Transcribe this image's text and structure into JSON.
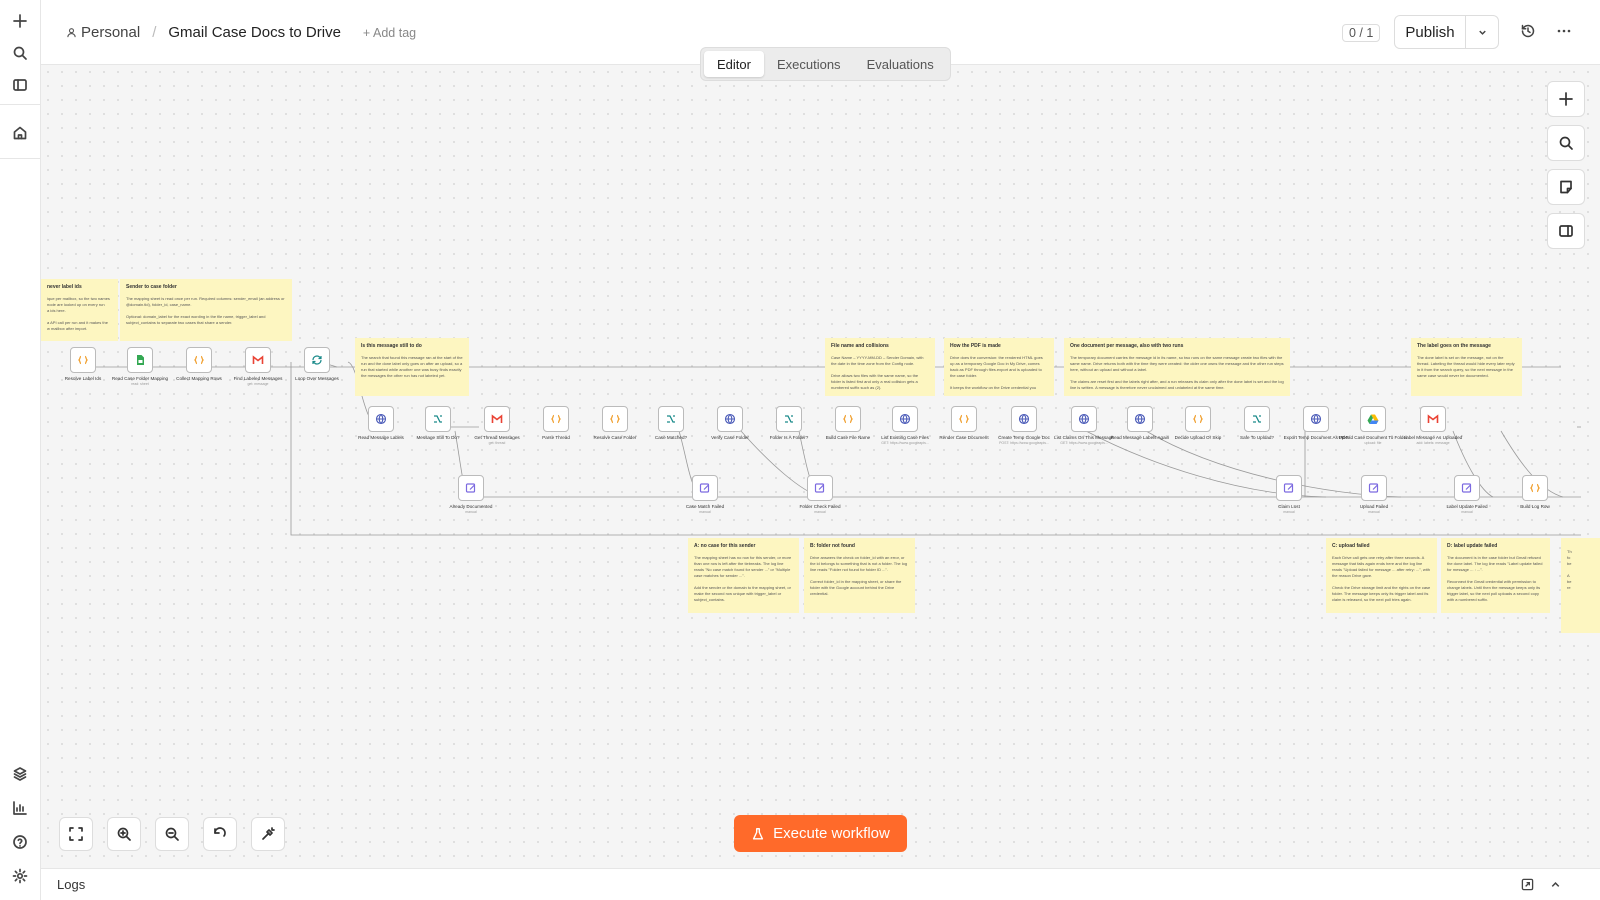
{
  "breadcrumb": {
    "project": "Personal",
    "separator": "/",
    "workflow_name": "Gmail Case Docs to Drive",
    "add_tag": "+ Add tag"
  },
  "header": {
    "counter": "0 / 1",
    "publish": "Publish"
  },
  "tabs": [
    {
      "label": "Editor"
    },
    {
      "label": "Executions"
    },
    {
      "label": "Evaluations"
    }
  ],
  "execute_button": "Execute workflow",
  "logs_label": "Logs",
  "icons": {
    "sidebar": [
      "plus-icon",
      "search-icon",
      "panel-icon",
      "home-icon",
      "templates-icon",
      "insights-icon",
      "help-icon",
      "settings-icon"
    ]
  },
  "colors": {
    "accent": "#ff6a2a",
    "sticky": "#fdf6c1",
    "code": "#f0a030",
    "gmail": "#ea4335",
    "sheets": "#34a853",
    "switch": "#1a8a8a",
    "http": "#4a5ab8",
    "set": "#7c6ae0"
  },
  "sticky_notes": [
    {
      "title": "never label ids",
      "body": "ique per mailbox, so the two names\n node are looked up on every run\n a ids here.\n\n a API call per run and it makes the\n w mailbox after import."
    },
    {
      "title": "Sender to case folder",
      "body": "The mapping sheet is read once per run. Required columns: sender_email (an address or @domain.tld), folder_id, case_name.\n\nOptional: domain_label for the exact wording in the file name, trigger_label and subject_contains to separate two cases that share a sender."
    },
    {
      "title": "Is this message still to do",
      "body": "The search that found this message ran at the start of the run and the done label only goes on after an upload, so a run that started while another one was busy finds exactly the messages the other run has not labeled yet."
    },
    {
      "title": "File name and collisions",
      "body": "Case Name – YYYY-MM-DD – Sender Domain, with the date in the time zone from the Config node.\n\nDrive allows two files with the same name, so the folder is listed first and only a real collision gets a numbered suffix such as (2)."
    },
    {
      "title": "How the PDF is made",
      "body": "Drive does the conversion: the rendered HTML goes up as a temporary Google Doc in My Drive, comes back as PDF through files.export and is uploaded to the case folder.\n\nIt keeps the workflow on the Drive credential you"
    },
    {
      "title": "One document per message, also with two runs",
      "body": "The temporary document carries the message id in its name, so two runs on the same message create two files with the same name. Drive returns both with the time they were created: the older one owns the message and the other run steps here, without an upload and without a label.\n\nThe claims are reset first and the labels right after, and a run releases its claim only after the done label is set and the log line is written. A message is therefore never unclaimed and unlabeled at the same time."
    },
    {
      "title": "The label goes on the message",
      "body": "The done label is set on the message, not on the thread. Labeling the thread would hide every later reply in it from the search query, so the next message in the same case would never be documented."
    },
    {
      "title": "A: no case for this sender",
      "body": "The mapping sheet has no row for this sender, or more than one row is left after the tiebreaks. The log line reads \"No case match found for sender ...\" or \"Multiple case matches for sender ...\".\n\nAdd the sender or the domain to the mapping sheet, or make the second row unique with trigger_label or subject_contains."
    },
    {
      "title": "B: folder not found",
      "body": "Drive answers the check on folder_id with an error, or the id belongs to something that is not a folder. The log line reads \"Folder not found for folder ID ...\".\n\nCorrect folder_id in the mapping sheet, or share the folder with the Google account behind the Drive credential."
    },
    {
      "title": "C: upload failed",
      "body": "Each Drive call gets one retry after three seconds. A message that fails again ends here and the log line reads \"Upload failed for message ... after retry: ...\", with the reason Drive gave.\n\nCheck the Drive storage limit and the rights on the case folder. The message keeps only its trigger label and its claim is released, so the next poll tries again."
    },
    {
      "title": "D: label update failed",
      "body": "The document is in the case folder but Gmail refused the done label. The log line reads \"Label update failed for message ... : ...\".\n\nReconnect the Gmail credential with permission to change labels. Until then the message keeps only its trigger label, so the next poll uploads a second copy with a numbered suffix."
    },
    {
      "title": "",
      "body": "Th\nfo\nbe\n\nA\nbe\nre"
    }
  ],
  "nodes": [
    {
      "label": "Resolve Label Ids",
      "sub": "",
      "type": "code"
    },
    {
      "label": "Read Case Folder Mapping",
      "sub": "read: sheet",
      "type": "sheets"
    },
    {
      "label": "Collect Mapping Rows",
      "sub": "",
      "type": "code"
    },
    {
      "label": "Find Labeled Messages",
      "sub": "get: message",
      "type": "gmail"
    },
    {
      "label": "Loop Over Messages",
      "sub": "",
      "type": "loop"
    },
    {
      "label": "Read Message Labels",
      "sub": "",
      "type": "http"
    },
    {
      "label": "Message Still To Do?",
      "sub": "",
      "type": "switch"
    },
    {
      "label": "Get Thread Messages",
      "sub": "get: thread",
      "type": "gmail"
    },
    {
      "label": "Parse Thread",
      "sub": "",
      "type": "code"
    },
    {
      "label": "Resolve Case Folder",
      "sub": "",
      "type": "code"
    },
    {
      "label": "Case Matched?",
      "sub": "",
      "type": "switch"
    },
    {
      "label": "Verify Case Folder",
      "sub": "",
      "type": "http"
    },
    {
      "label": "Folder Is A Folder?",
      "sub": "",
      "type": "switch"
    },
    {
      "label": "Build Case File Name",
      "sub": "",
      "type": "code"
    },
    {
      "label": "List Existing Case Files",
      "sub": "GET: https://www.googleapis...",
      "type": "http"
    },
    {
      "label": "Render Case Document",
      "sub": "",
      "type": "code"
    },
    {
      "label": "Create Temp Google Doc",
      "sub": "POST: https://www.googleapis...",
      "type": "http"
    },
    {
      "label": "List Claims On This Message",
      "sub": "GET: https://www.googleapis...",
      "type": "http"
    },
    {
      "label": "Read Message Labels Again",
      "sub": "",
      "type": "http"
    },
    {
      "label": "Decide Upload Or Skip",
      "sub": "",
      "type": "code"
    },
    {
      "label": "Safe To Upload?",
      "sub": "",
      "type": "switch"
    },
    {
      "label": "Export Temp Document As PDF",
      "sub": "",
      "type": "http"
    },
    {
      "label": "Upload Case Document To Folder",
      "sub": "upload: file",
      "type": "drive"
    },
    {
      "label": "Label Message As Uploaded",
      "sub": "add: labels: message",
      "type": "gmail"
    },
    {
      "label": "Already Documented",
      "sub": "manual",
      "type": "set"
    },
    {
      "label": "Case Match Failed",
      "sub": "manual",
      "type": "set"
    },
    {
      "label": "Folder Check Failed",
      "sub": "manual",
      "type": "set"
    },
    {
      "label": "Claim Lost",
      "sub": "manual",
      "type": "set"
    },
    {
      "label": "Upload Failed",
      "sub": "manual",
      "type": "set"
    },
    {
      "label": "Label Update Failed",
      "sub": "manual",
      "type": "set"
    },
    {
      "label": "Build Log Row",
      "sub": "",
      "type": "code"
    }
  ]
}
